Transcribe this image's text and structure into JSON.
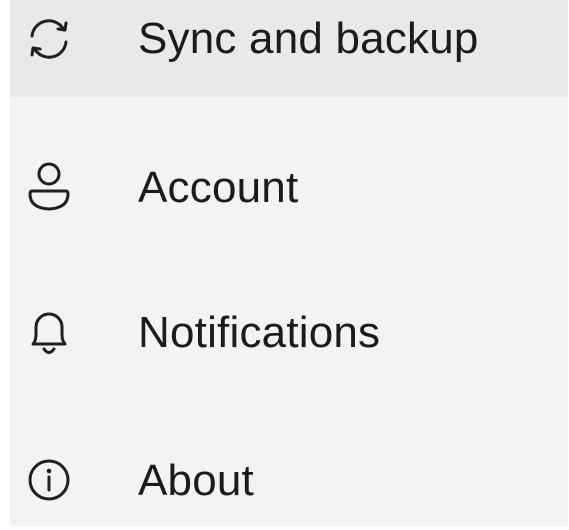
{
  "menu": {
    "items": [
      {
        "label": "Sync and backup",
        "icon": "sync-icon",
        "selected": true
      },
      {
        "label": "Account",
        "icon": "person-icon",
        "selected": false
      },
      {
        "label": "Notifications",
        "icon": "bell-icon",
        "selected": false
      },
      {
        "label": "About",
        "icon": "info-icon",
        "selected": false
      }
    ]
  },
  "colors": {
    "panel_background": "#f3f3f3",
    "selected_background": "#e9e9e9",
    "text": "#1b1b1b",
    "icon_stroke": "#1f1f1f"
  }
}
